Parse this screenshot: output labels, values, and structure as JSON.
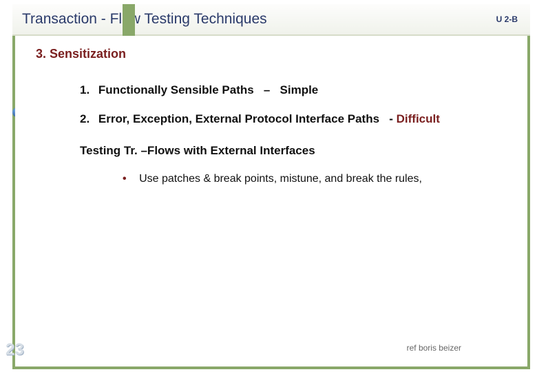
{
  "header": {
    "title": "Transaction - Flow Testing  Techniques",
    "tag": "U 2-B"
  },
  "section": {
    "number": "3.",
    "title": "Sensitization"
  },
  "items": [
    {
      "num": "1.",
      "text": "Functionally Sensible Paths",
      "sep": "–",
      "note": "Simple",
      "noteClass": "simple"
    },
    {
      "num": "2.",
      "text": "Error, Exception, External Protocol Interface Paths",
      "sep": "-",
      "note": "Difficult",
      "noteClass": "difficult"
    }
  ],
  "subheading": "Testing Tr. –Flows with External Interfaces",
  "bullets": [
    "Use patches & break points, mistune, and break the rules,"
  ],
  "footer": {
    "slide_number": "23",
    "reference": "ref boris beizer"
  }
}
